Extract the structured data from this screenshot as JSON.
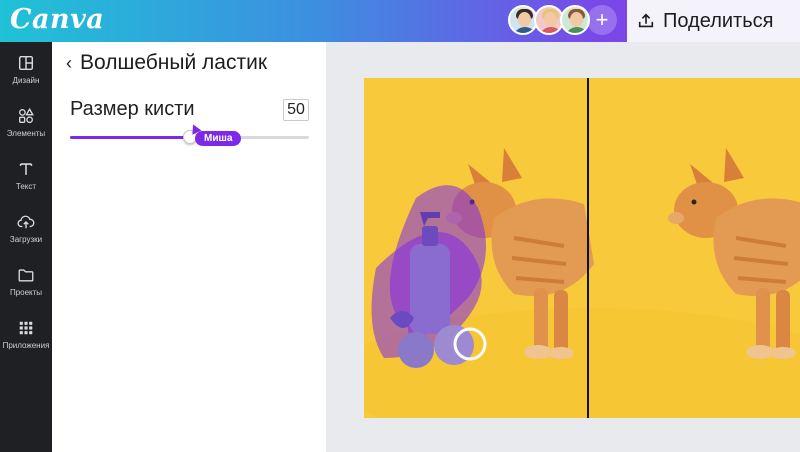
{
  "app": {
    "logo_text": "Canva"
  },
  "header": {
    "avatars": [
      {
        "name": "avatar-1",
        "hair": "#3b2a20",
        "shirt": "#2d5b8a",
        "bg": "#cfe3f1"
      },
      {
        "name": "avatar-2",
        "hair": "#e9c27c",
        "shirt": "#d45b5b",
        "bg": "#f2c9c9"
      },
      {
        "name": "avatar-3",
        "hair": "#8a5a35",
        "shirt": "#4c8f5a",
        "bg": "#cfe8d6"
      }
    ],
    "add_label": "+",
    "share_label": "Поделиться",
    "share_icon": "upload-icon"
  },
  "sidebar": {
    "items": [
      {
        "label": "Дизайн",
        "icon": "layout-icon"
      },
      {
        "label": "Элементы",
        "icon": "shapes-icon"
      },
      {
        "label": "Текст",
        "icon": "text-icon"
      },
      {
        "label": "Загрузки",
        "icon": "cloud-upload-icon"
      },
      {
        "label": "Проекты",
        "icon": "folder-icon"
      },
      {
        "label": "Приложения",
        "icon": "grid-icon"
      }
    ]
  },
  "panel": {
    "title": "Волшебный ластик",
    "back_icon": "chevron-left-icon",
    "brush_label": "Размер кисти",
    "brush_value": "50",
    "slider_fraction": 0.5,
    "cursor_tag": "Миша"
  },
  "colors": {
    "accent": "#7d2ae8",
    "photo_bg": "#f8c93b",
    "erase_overlay": "#7d2ae8"
  }
}
